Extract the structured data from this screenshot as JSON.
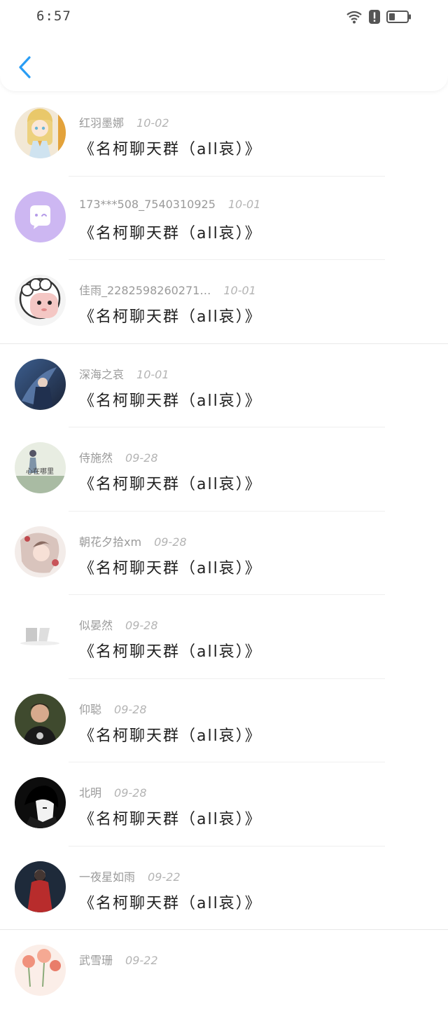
{
  "status": {
    "time": "6:57"
  },
  "items": [
    {
      "name": "红羽墨娜",
      "date": "10-02",
      "title": "《名柯聊天群（all哀）》"
    },
    {
      "name": "173***508_7540310925",
      "date": "10-01",
      "title": "《名柯聊天群（all哀）》"
    },
    {
      "name": "佳雨_2282598260271…",
      "date": "10-01",
      "title": "《名柯聊天群（all哀）》"
    },
    {
      "name": "深海之哀",
      "date": "10-01",
      "title": "《名柯聊天群（all哀）》"
    },
    {
      "name": "侍施然",
      "date": "09-28",
      "title": "《名柯聊天群（all哀）》",
      "avatar_text": "心在哪里"
    },
    {
      "name": "朝花夕拾xm",
      "date": "09-28",
      "title": "《名柯聊天群（all哀）》"
    },
    {
      "name": "似晏然",
      "date": "09-28",
      "title": "《名柯聊天群（all哀）》"
    },
    {
      "name": "仰聪",
      "date": "09-28",
      "title": "《名柯聊天群（all哀）》"
    },
    {
      "name": "北明",
      "date": "09-28",
      "title": "《名柯聊天群（all哀）》"
    },
    {
      "name": "一夜星如雨",
      "date": "09-22",
      "title": "《名柯聊天群（all哀）》"
    },
    {
      "name": "武雪珊",
      "date": "09-22",
      "title": ""
    }
  ]
}
